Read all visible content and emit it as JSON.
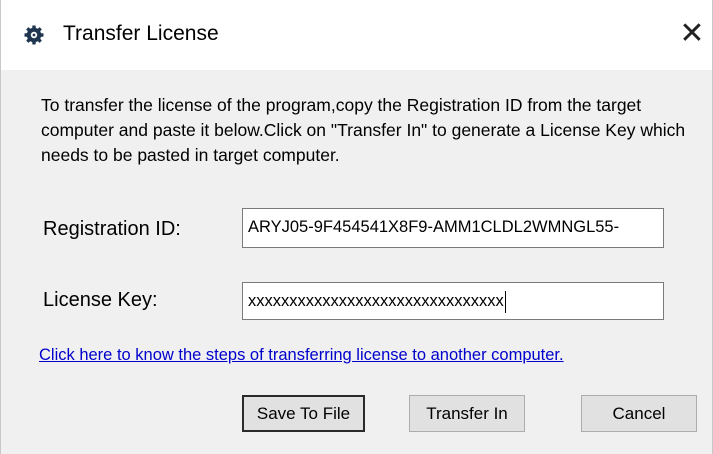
{
  "window": {
    "title": "Transfer License",
    "close_glyph": "✕",
    "icon": "app-gear-icon"
  },
  "description": "To transfer the license of the program,copy the Registration ID from the target computer and paste it below.Click on \"Transfer In\" to generate a License Key which needs to be pasted in target computer.",
  "registration": {
    "label": "Registration ID:",
    "value": "ARYJ05-9F454541X8F9-AMM1CLDL2WMNGL55-"
  },
  "license": {
    "label": "License Key:",
    "value": "xxxxxxxxxxxxxxxxxxxxxxxxxxxxxxx"
  },
  "help_link": "Click here to know the steps of transferring license to another computer.",
  "buttons": {
    "save": "Save To File",
    "transfer": "Transfer In",
    "cancel": "Cancel"
  },
  "colors": {
    "link": "#0000cc",
    "dialog_bg": "#f0f0f0",
    "button_bg": "#e1e1e1"
  }
}
